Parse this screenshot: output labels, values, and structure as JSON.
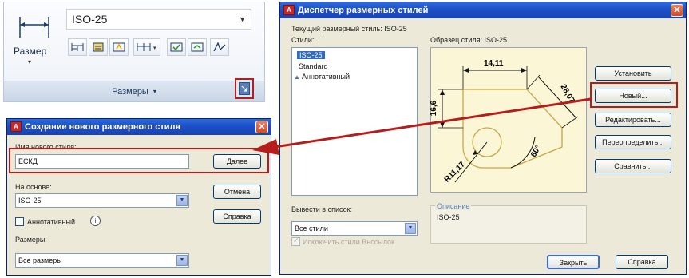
{
  "ribbon": {
    "style_value": "ISO-25",
    "size_label": "Размер",
    "panel_title": "Размеры"
  },
  "new_style_dialog": {
    "title": "Создание нового размерного стиля",
    "name_label": "Имя нового стиля:",
    "name_value": "ЕСКД",
    "continue_button": "Далее",
    "based_on_label": "На основе:",
    "based_on_value": "ISO-25",
    "cancel_button": "Отмена",
    "annotative_label": "Аннотативный",
    "help_button": "Справка",
    "use_for_label": "Размеры:",
    "use_for_value": "Все размеры"
  },
  "manager_dialog": {
    "title": "Диспетчер размерных стилей",
    "current_style_label": "Текущий размерный стиль: ISO-25",
    "styles_label": "Стили:",
    "styles": [
      "ISO-25",
      "Standard",
      "Аннотативный"
    ],
    "preview_label": "Образец стиля: ISO-25",
    "buttons": {
      "set_current": "Установить",
      "new": "Новый...",
      "modify": "Редактировать...",
      "override": "Переопределить...",
      "compare": "Сравнить..."
    },
    "list_label": "Вывести в список:",
    "list_value": "Все стили",
    "exclude_xref_label": "Исключить стили Внссылок",
    "description_label": "Описание",
    "description_value": "ISO-25",
    "close_button": "Закрыть",
    "help_button": "Справка"
  },
  "preview_drawing": {
    "dim_top": "14,11",
    "dim_left": "16,6",
    "dim_right": "28,07",
    "dim_angle": "60°",
    "dim_radius": "R11,17"
  },
  "colors": {
    "accent_red": "#b61c1c",
    "xp_title_blue": "#1d4fc6",
    "preview_bg": "#fbf7d6"
  }
}
